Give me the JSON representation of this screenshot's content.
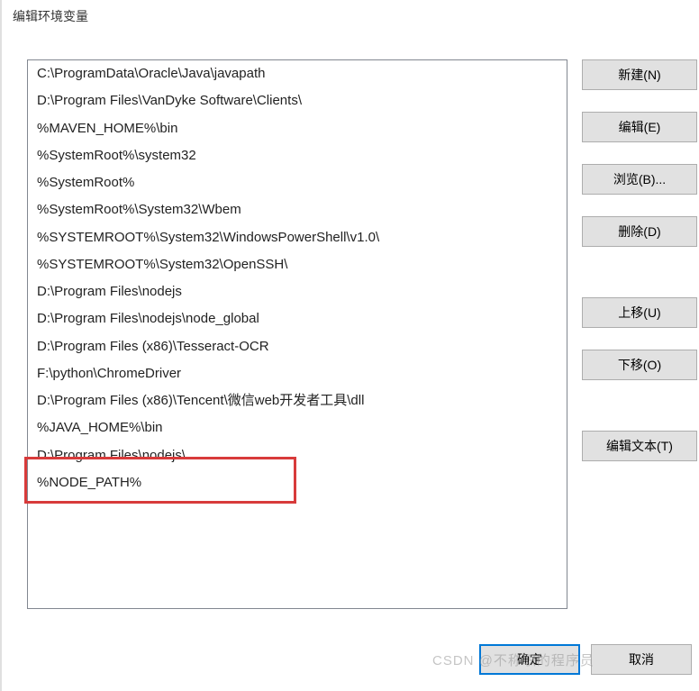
{
  "window": {
    "title": "编辑环境变量"
  },
  "path_entries": [
    "C:\\ProgramData\\Oracle\\Java\\javapath",
    "D:\\Program Files\\VanDyke Software\\Clients\\",
    "%MAVEN_HOME%\\bin",
    "%SystemRoot%\\system32",
    "%SystemRoot%",
    "%SystemRoot%\\System32\\Wbem",
    "%SYSTEMROOT%\\System32\\WindowsPowerShell\\v1.0\\",
    "%SYSTEMROOT%\\System32\\OpenSSH\\",
    "D:\\Program Files\\nodejs",
    "D:\\Program Files\\nodejs\\node_global",
    "D:\\Program Files (x86)\\Tesseract-OCR",
    "F:\\python\\ChromeDriver",
    "D:\\Program Files (x86)\\Tencent\\微信web开发者工具\\dll",
    "%JAVA_HOME%\\bin",
    "D:\\Program Files\\nodejs\\",
    "%NODE_PATH%"
  ],
  "buttons": {
    "new": "新建(N)",
    "edit": "编辑(E)",
    "browse": "浏览(B)...",
    "delete": "删除(D)",
    "move_up": "上移(U)",
    "move_down": "下移(O)",
    "edit_text": "编辑文本(T)",
    "ok": "确定",
    "cancel": "取消"
  },
  "watermark": "CSDN @不称职的程序员"
}
